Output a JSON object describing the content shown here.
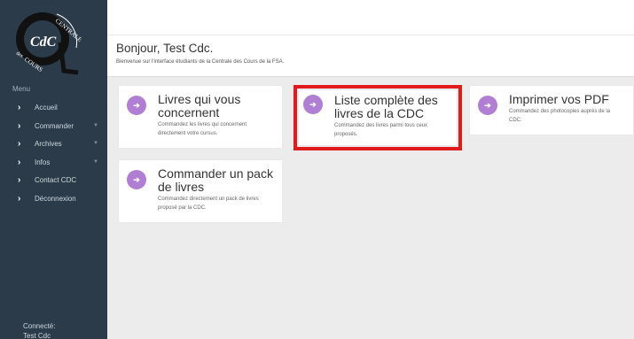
{
  "logo": {
    "top_text": "CENTRALE",
    "mid_text": "des",
    "bottom_text": "COURS",
    "monogram": "CdC"
  },
  "sidebar": {
    "menu_title": "Menu",
    "items": [
      {
        "label": "Accueil",
        "has_caret": false
      },
      {
        "label": "Commander",
        "has_caret": true
      },
      {
        "label": "Archives",
        "has_caret": true
      },
      {
        "label": "Infos",
        "has_caret": true
      },
      {
        "label": "Contact CDC",
        "has_caret": false
      },
      {
        "label": "Déconnexion",
        "has_caret": false
      }
    ],
    "connected_label": "Connecté:",
    "connected_user": "Test Cdc"
  },
  "header": {
    "greeting_prefix": "Bonjour,",
    "greeting_name": "Test Cdc",
    "greeting_suffix": ".",
    "subtitle": "Bienvenue sur l'interface étudiants de la Centrale des Cours de la FSA."
  },
  "cards": [
    {
      "title": "Livres qui vous concernent",
      "description": "Commandez les livres qui concernent directement votre cursus.",
      "icon": "arrow-right-icon"
    },
    {
      "title": "Liste complète des livres de la CDC",
      "description": "Commandez des livres parmi tous ceux proposés.",
      "icon": "arrow-right-icon",
      "highlighted": true
    },
    {
      "title": "Imprimer vos PDF",
      "description": "Commandez des photocopies auprès de la CDC.",
      "icon": "arrow-right-icon"
    },
    {
      "title": "Commander un pack de livres",
      "description": "Commandez directement un pack de livres proposé par la CDC.",
      "icon": "arrow-right-icon"
    }
  ],
  "colors": {
    "sidebar": "#2b3b4a",
    "accent_circle": "#b07fd4",
    "highlight_box": "#e11b1b",
    "background": "#ececec"
  }
}
